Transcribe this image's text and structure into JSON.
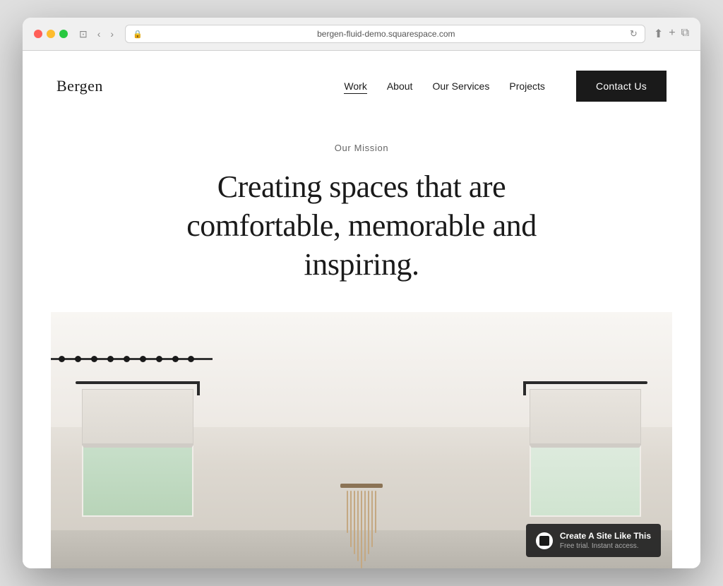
{
  "browser": {
    "url": "bergen-fluid-demo.squarespace.com",
    "back_btn": "‹",
    "forward_btn": "›"
  },
  "nav": {
    "logo": "Bergen",
    "links": [
      {
        "label": "Work",
        "active": true
      },
      {
        "label": "About",
        "active": false
      },
      {
        "label": "Our Services",
        "active": false
      },
      {
        "label": "Projects",
        "active": false
      }
    ],
    "cta_label": "Contact Us"
  },
  "hero": {
    "label": "Our Mission",
    "title": "Creating spaces that are comfortable, memorable and inspiring."
  },
  "badge": {
    "title": "Create A Site Like This",
    "subtitle": "Free trial. Instant access."
  }
}
